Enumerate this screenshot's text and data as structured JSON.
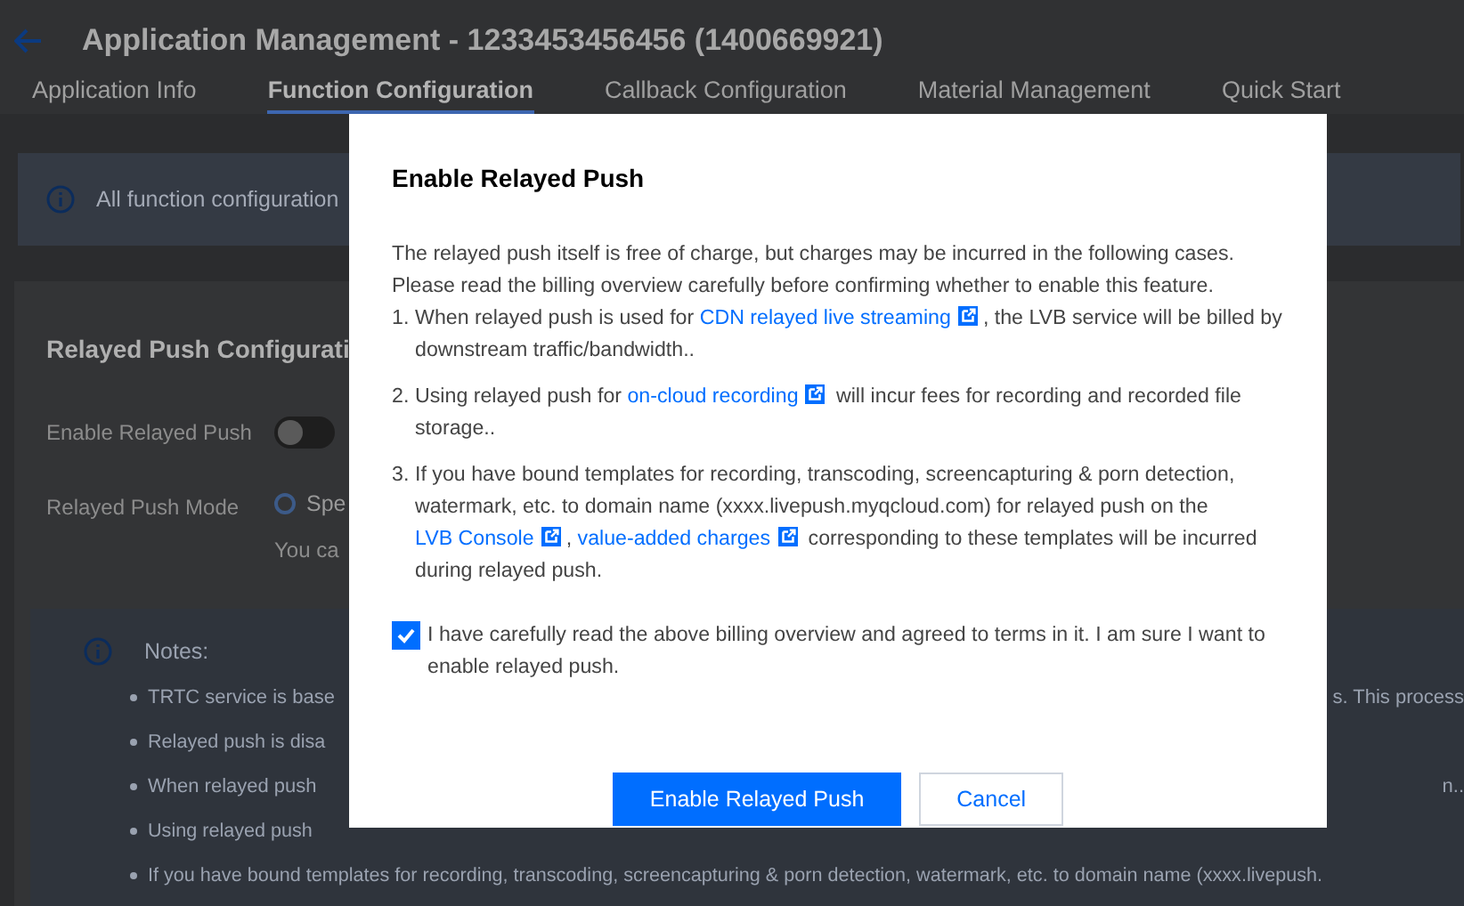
{
  "header": {
    "title": "Application Management - 1233453456456  (1400669921)"
  },
  "tabs": [
    {
      "label": "Application Info",
      "selected": false
    },
    {
      "label": "Function Configuration",
      "selected": true
    },
    {
      "label": "Callback Configuration",
      "selected": false
    },
    {
      "label": "Material Management",
      "selected": false
    },
    {
      "label": "Quick Start",
      "selected": false
    }
  ],
  "info_banner": {
    "text": "All function configuration"
  },
  "card": {
    "title": "Relayed Push Configurati",
    "fields": [
      {
        "kind": "toggle",
        "label": "Enable Relayed Push",
        "on": false
      },
      {
        "kind": "radio",
        "label": "Relayed Push Mode",
        "option": "Spe",
        "selected": false,
        "hint": "You ca"
      }
    ]
  },
  "notes": {
    "title": "Notes:",
    "items": [
      {
        "text": "TRTC service is base",
        "tail": "s. This process"
      },
      {
        "text": "Relayed push is disa"
      },
      {
        "text": "When relayed push",
        "tail": "n.."
      },
      {
        "text": "Using relayed push"
      },
      {
        "text": "If you have bound templates for recording, transcoding, screencapturing & porn detection, watermark, etc. to domain name (xxxx.livepush."
      }
    ]
  },
  "dialog": {
    "title": "Enable Relayed Push",
    "intro": "The relayed push itself is free of charge, but charges may be incurred in the following cases. Please read the billing overview carefully before confirming whether to enable this feature.",
    "items": [
      {
        "number": "1.",
        "segments": [
          {
            "kind": "text",
            "text": "When relayed push is used for "
          },
          {
            "kind": "link",
            "text": "CDN relayed live streaming"
          },
          {
            "kind": "text",
            "text": ", the LVB service will be billed by downstream traffic/bandwidth.."
          }
        ]
      },
      {
        "number": "2.",
        "segments": [
          {
            "kind": "text",
            "text": "Using relayed push for "
          },
          {
            "kind": "link",
            "text": "on-cloud recording"
          },
          {
            "kind": "text",
            "text": " will incur fees for recording and recorded file storage.."
          }
        ]
      },
      {
        "number": "3.",
        "segments": [
          {
            "kind": "text",
            "text": "If you have bound templates for recording, transcoding, screencapturing & porn detection, watermark, etc. to domain name (xxxx.livepush.myqcloud.com) for relayed push on the "
          },
          {
            "kind": "link",
            "text": "LVB Console"
          },
          {
            "kind": "text",
            "text": ", "
          },
          {
            "kind": "link",
            "text": "value-added charges"
          },
          {
            "kind": "text",
            "text": " corresponding to these templates will be incurred during relayed push."
          }
        ]
      }
    ],
    "agreement": {
      "checked": true,
      "text": "I have carefully read the above billing overview and agreed to terms in it. I am sure I want to enable relayed push."
    },
    "buttons": [
      {
        "kind": "primary",
        "label": "Enable Relayed Push"
      },
      {
        "kind": "secondary",
        "label": "Cancel"
      }
    ]
  }
}
